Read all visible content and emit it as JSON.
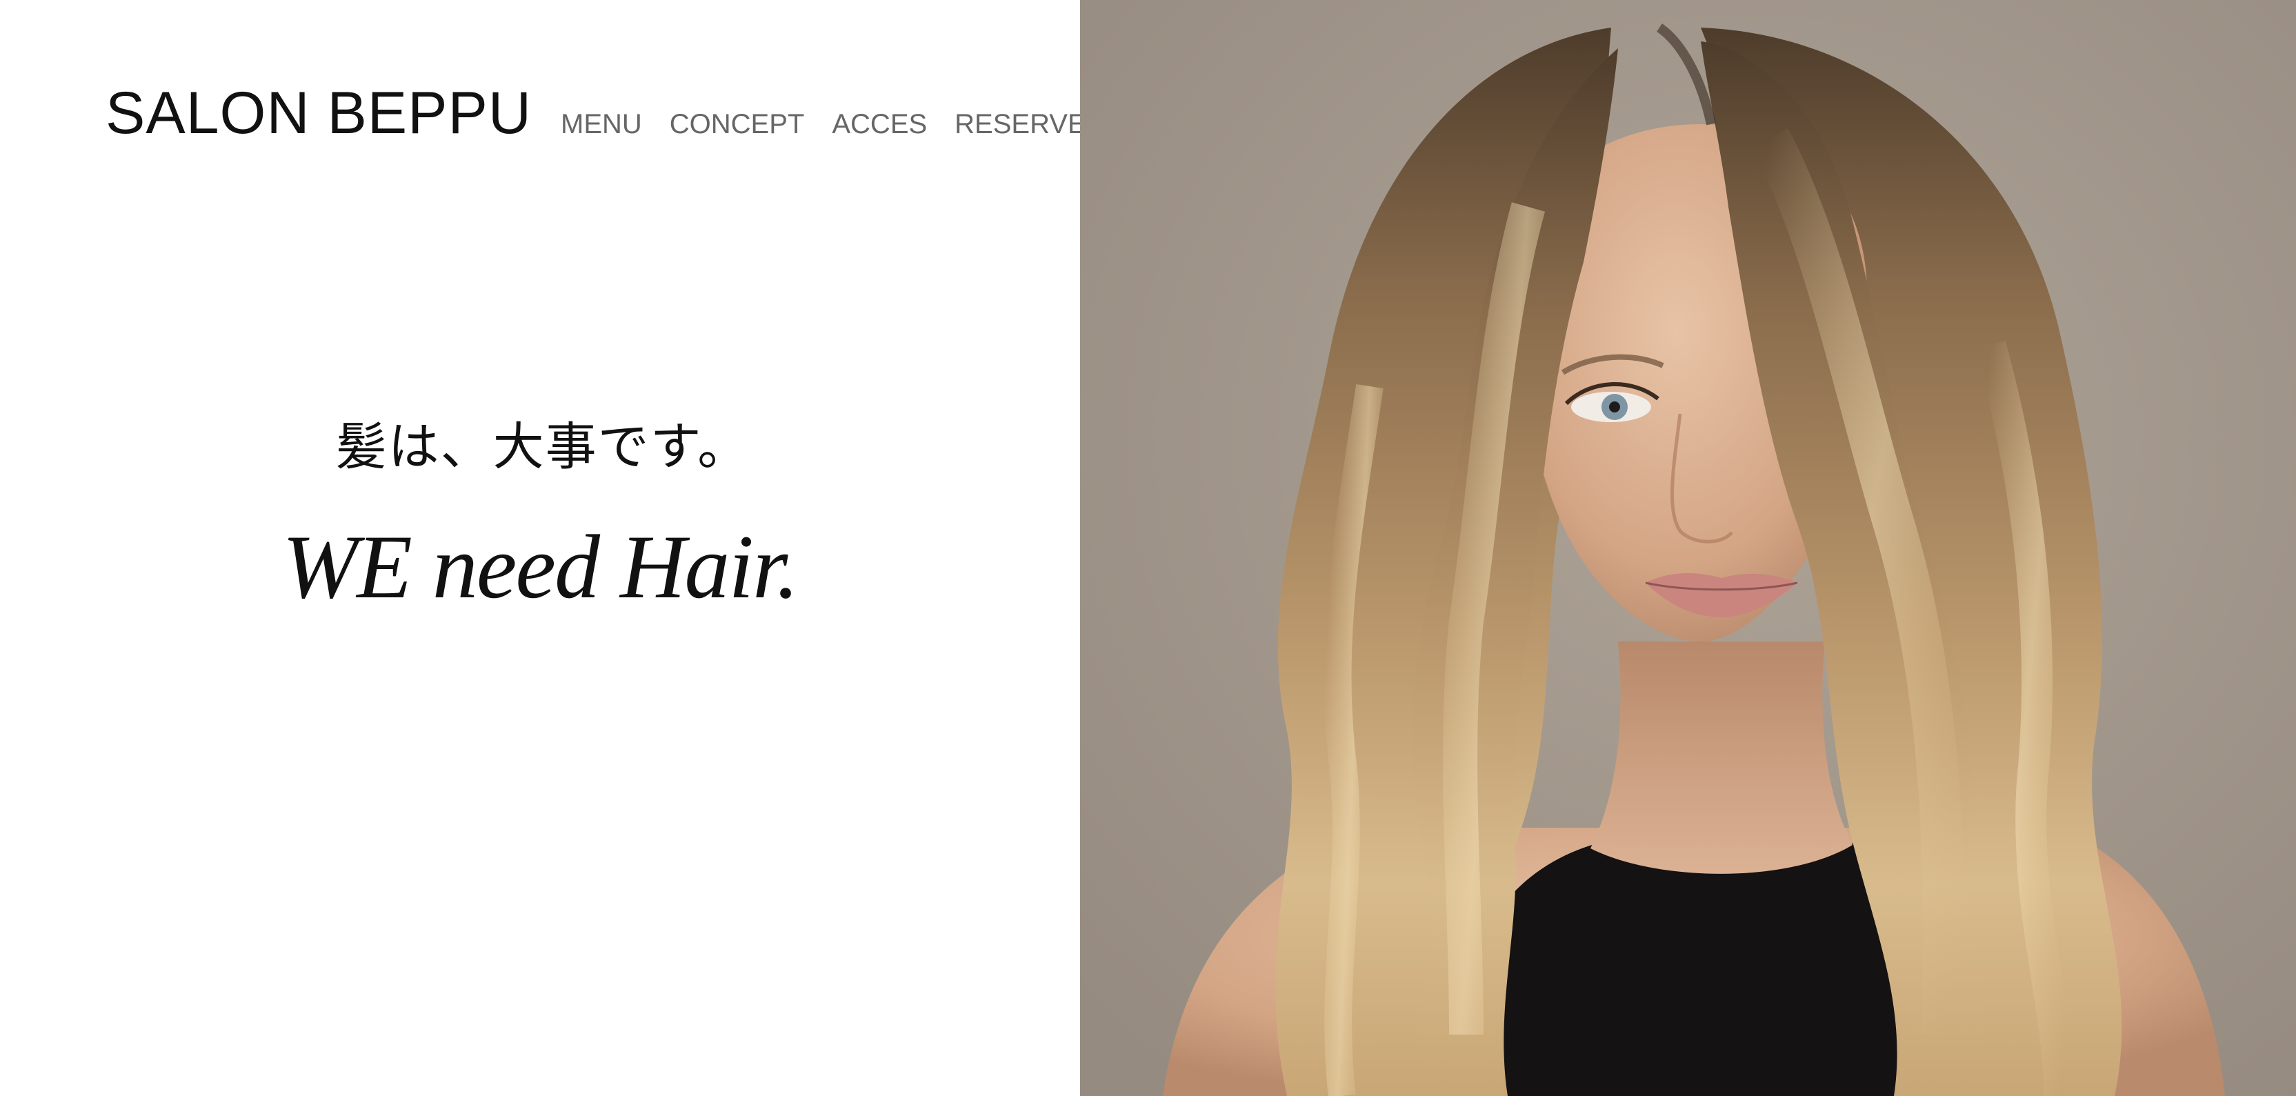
{
  "header": {
    "logo": "SALON BEPPU",
    "nav": [
      "MENU",
      "CONCEPT",
      "ACCES",
      "RESERVE"
    ]
  },
  "hero": {
    "tagline_jp": "髪は、大事です。",
    "tagline_en": "WE need Hair.",
    "image_alt": "Portrait photo of a woman with long wavy blonde-brown hair and black top"
  },
  "colors": {
    "background": "#ffffff",
    "text": "#111111",
    "nav_text": "#666666",
    "photo_backdrop": "#a1968b"
  }
}
